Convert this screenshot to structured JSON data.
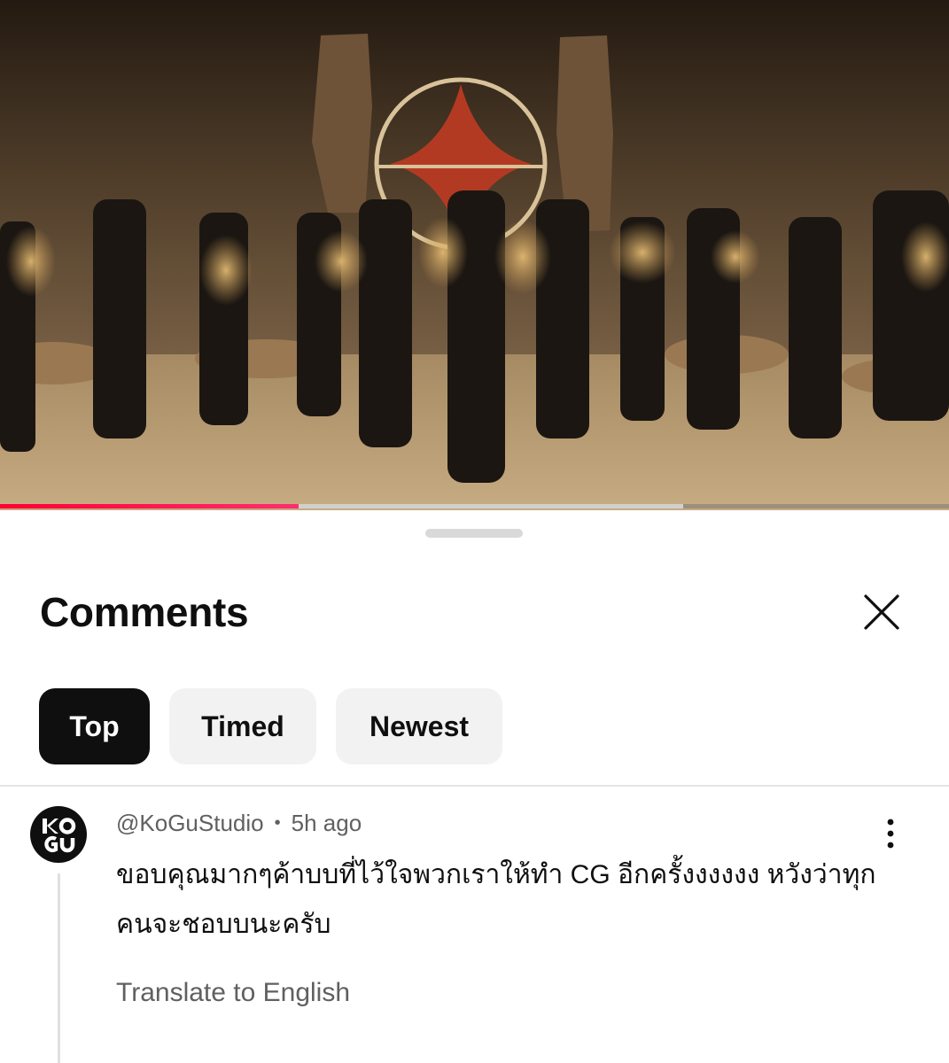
{
  "video": {
    "thumbnail_icon": "music-video-frame",
    "progress": {
      "played_fraction": 0.315,
      "buffered_fraction": 0.72
    },
    "colors": {
      "played": "#ff0033",
      "buffered": "#dcdcdc"
    }
  },
  "sheet": {
    "title": "Comments",
    "close_icon": "close-icon",
    "sort_chips": [
      {
        "label": "Top",
        "selected": true
      },
      {
        "label": "Timed",
        "selected": false
      },
      {
        "label": "Newest",
        "selected": false
      }
    ]
  },
  "comment": {
    "author": "@KoGuStudio",
    "separator": "•",
    "time": "5h ago",
    "text": "ขอบคุณมากๆค้าบบที่ไว้ใจพวกเราให้ทำ CG อีกครั้งงงงงง หวังว่าทุกคนจะชอบบนะครับ",
    "translate": "Translate to English",
    "avatar_icon": "kogu-logo-icon",
    "menu_icon": "more-vertical-icon"
  }
}
